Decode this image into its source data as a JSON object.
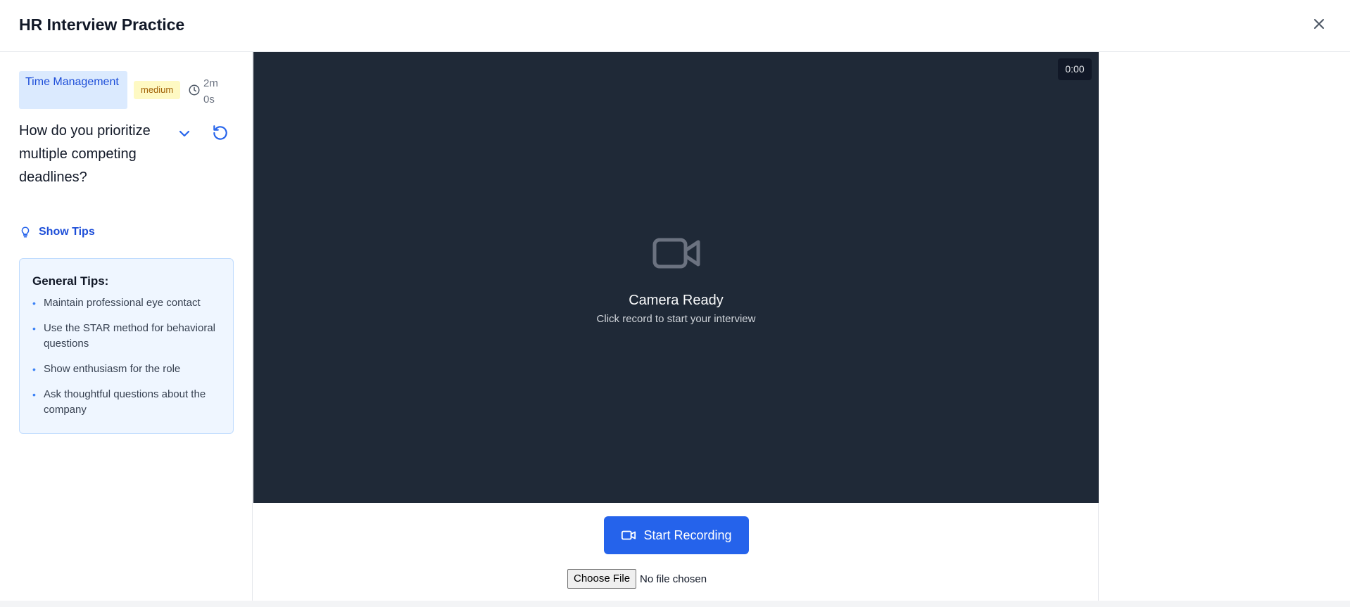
{
  "header": {
    "title": "HR Interview Practice"
  },
  "question": {
    "category": "Time Management",
    "difficulty": "medium",
    "time_limit": "2m 0s",
    "text": "How do you prioritize multiple competing deadlines?",
    "show_tips_label": "Show Tips"
  },
  "tips": {
    "heading": "General Tips:",
    "items": [
      "Maintain professional eye contact",
      "Use the STAR method for behavioral questions",
      "Show enthusiasm for the role",
      "Ask thoughtful questions about the company"
    ]
  },
  "video": {
    "timer": "0:00",
    "status_title": "Camera Ready",
    "status_subtitle": "Click record to start your interview"
  },
  "controls": {
    "record_label": "Start Recording",
    "file_button_label": "Choose File",
    "file_status": "No file chosen"
  },
  "colors": {
    "accent": "#2563eb",
    "video_bg": "#1f2937",
    "category_bg": "#dbeafe",
    "difficulty_bg": "#fef9c3"
  },
  "icons": [
    "close-icon",
    "clock-icon",
    "chevron-down-icon",
    "reset-icon",
    "lightbulb-icon",
    "video-camera-icon"
  ]
}
